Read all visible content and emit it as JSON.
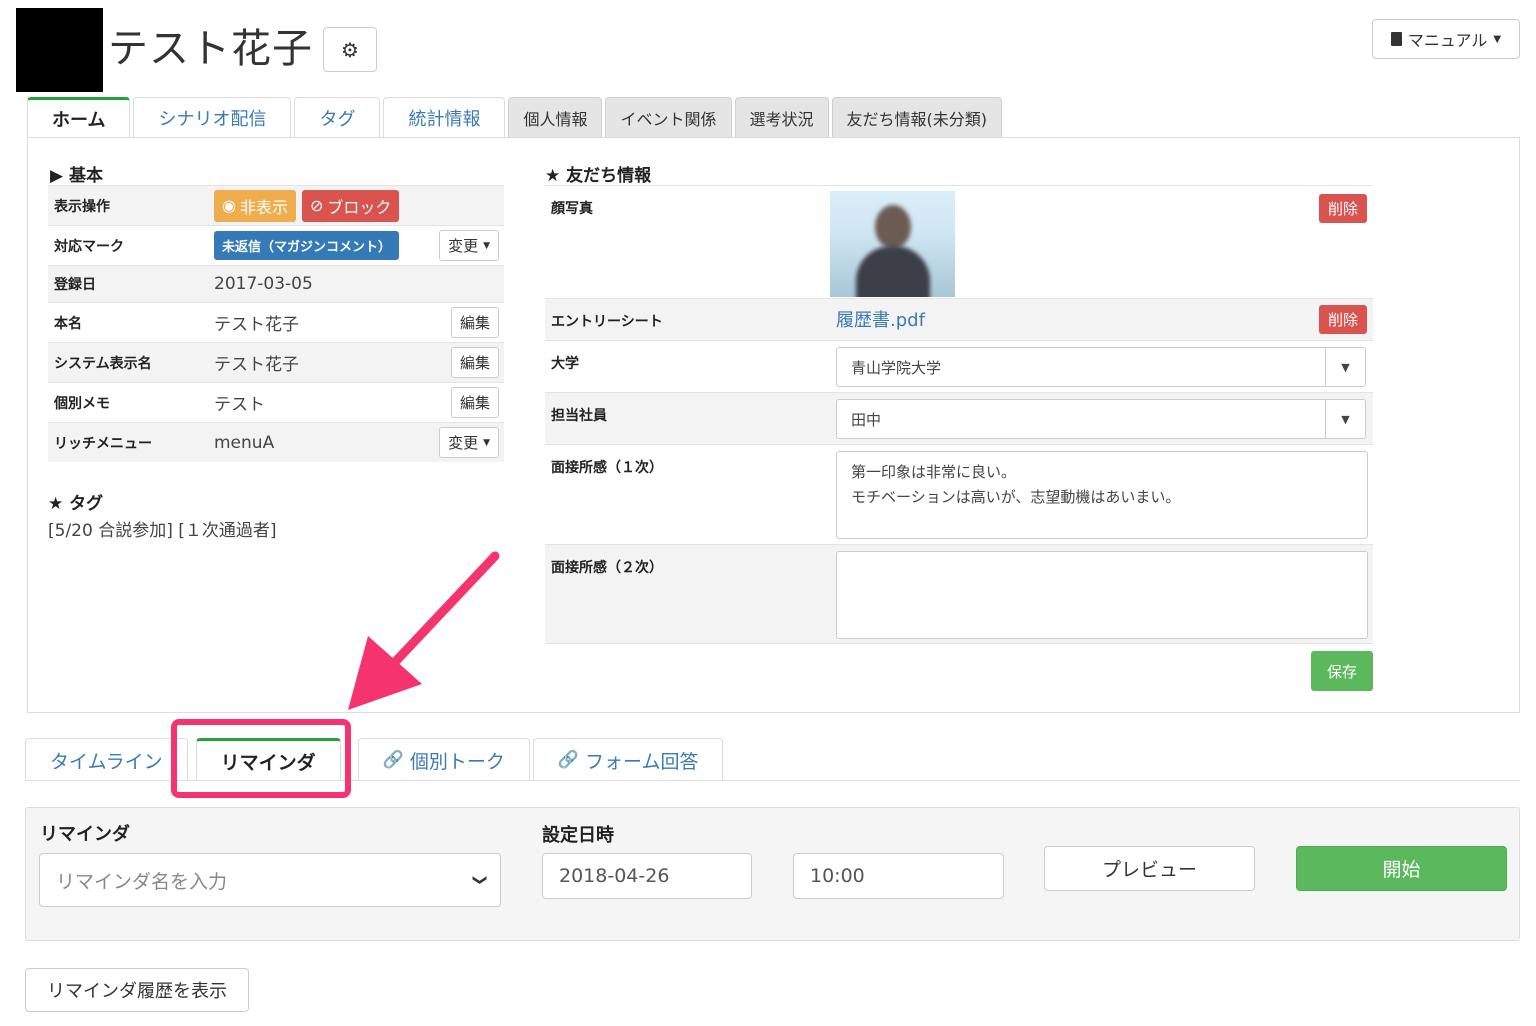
{
  "header": {
    "title": "テスト花子",
    "manual_label": "マニュアル"
  },
  "tabs": [
    {
      "label": "ホーム"
    },
    {
      "label": "シナリオ配信"
    },
    {
      "label": "タグ"
    },
    {
      "label": "統計情報"
    },
    {
      "label": "個人情報"
    },
    {
      "label": "イベント関係"
    },
    {
      "label": "選考状況"
    },
    {
      "label": "友だち情報(未分類)"
    }
  ],
  "basic": {
    "heading": "▶ 基本",
    "rows": [
      {
        "key": "表示操作"
      },
      {
        "key": "対応マーク",
        "badge": "未返信（マガジンコメント）",
        "action": "変更"
      },
      {
        "key": "登録日",
        "value": "2017-03-05"
      },
      {
        "key": "本名",
        "value": "テスト花子",
        "action": "編集"
      },
      {
        "key": "システム表示名",
        "value": "テスト花子",
        "action": "編集"
      },
      {
        "key": "個別メモ",
        "value": "テスト",
        "action": "編集"
      },
      {
        "key": "リッチメニュー",
        "value": "menuA",
        "action": "変更"
      }
    ],
    "hide_label": "非表示",
    "block_label": "ブロック"
  },
  "tags": {
    "heading": "★ タグ",
    "value": "[5/20 合説参加] [１次通過者]"
  },
  "friend_info": {
    "heading": "★ 友だち情報",
    "photo_label": "顔写真",
    "delete_label": "削除",
    "entry_label": "エントリーシート",
    "entry_file": "履歴書.pdf",
    "university_label": "大学",
    "university_value": "青山学院大学",
    "staff_label": "担当社員",
    "staff_value": "田中",
    "interview1_label": "面接所感（１次）",
    "interview1_value": "第一印象は非常に良い。\nモチベーションは高いが、志望動機はあいまい。",
    "interview2_label": "面接所感（２次）",
    "interview2_value": "",
    "save_label": "保存"
  },
  "bottom_tabs": [
    {
      "label": "タイムライン"
    },
    {
      "label": "リマインダ"
    },
    {
      "label": "個別トーク"
    },
    {
      "label": "フォーム回答"
    }
  ],
  "reminder": {
    "label": "リマインダ",
    "placeholder": "リマインダ名を入力",
    "datetime_label": "設定日時",
    "date": "2018-04-26",
    "time": "10:00",
    "preview_label": "プレビュー",
    "start_label": "開始",
    "history_label": "リマインダ履歴を表示"
  },
  "colors": {
    "accent_green": "#5cb85c",
    "danger": "#d9534f",
    "warning": "#f0ad4e",
    "primary": "#337ab7",
    "annotation": "#f5336f"
  }
}
